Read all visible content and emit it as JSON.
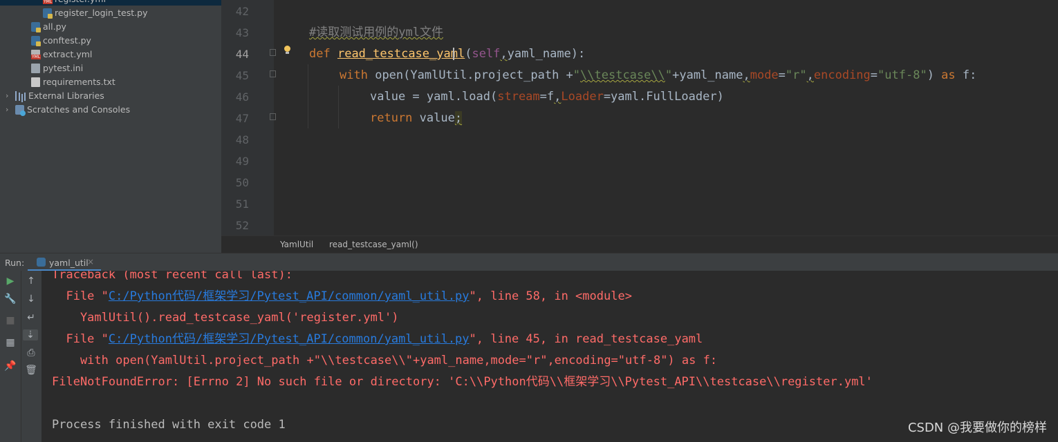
{
  "project_tree": {
    "items": [
      {
        "label": "register.yml",
        "icon": "yml-file-icon"
      },
      {
        "label": "register_login_test.py",
        "icon": "python-file-icon"
      },
      {
        "label": "all.py",
        "icon": "python-file-icon"
      },
      {
        "label": "conftest.py",
        "icon": "python-file-icon"
      },
      {
        "label": "extract.yml",
        "icon": "yml-file-icon"
      },
      {
        "label": "pytest.ini",
        "icon": "ini-file-icon"
      },
      {
        "label": "requirements.txt",
        "icon": "text-file-icon"
      },
      {
        "label": "External Libraries",
        "icon": "library-icon"
      },
      {
        "label": "Scratches and Consoles",
        "icon": "scratches-icon"
      }
    ]
  },
  "editor": {
    "line_numbers": [
      "42",
      "43",
      "44",
      "45",
      "46",
      "47",
      "48",
      "49",
      "50",
      "51",
      "52"
    ],
    "current_line": "44",
    "comment": "#读取测试用例的yml文件",
    "def_kw": "def",
    "func_name_a": "read_testcase_y",
    "func_name_b": "aml",
    "paren_open": "(",
    "self_kw": "self",
    "comma": ",",
    "params_end": "yaml_name):",
    "with_kw": "with",
    "open_call": "open(YamlUtil.project_path +",
    "str_q1": "\"",
    "str_path": "\\\\testcase\\\\",
    "str_q2": "\"",
    "plus_name": "+yaml_name",
    "mode_kw": "mode",
    "eq": "=",
    "mode_val": "\"r\"",
    "encoding_kw": "encoding",
    "encoding_val": "\"utf-8\"",
    "close_paren": ") ",
    "as_kw": "as",
    "as_tail": " f:",
    "value_assign": "value = yaml.load(",
    "stream_kw": "stream",
    "eq_f": "=f",
    "loader_kw": "Loader",
    "loader_tail": "=yaml.FullLoader)",
    "return_kw": "return",
    "return_val": " value",
    "semicolon": ";"
  },
  "breadcrumb": {
    "class": "YamlUtil",
    "method": "read_testcase_yaml()"
  },
  "run_panel": {
    "label": "Run:",
    "tab": "yaml_util",
    "output": {
      "l1": "Traceback (most recent call last):",
      "l2_pre": "  File \"",
      "l2_link": "C:/Python代码/框架学习/Pytest_API/common/yaml_util.py",
      "l2_post": "\", line 58, in <module>",
      "l3": "    YamlUtil().read_testcase_yaml('register.yml')",
      "l4_pre": "  File \"",
      "l4_link": "C:/Python代码/框架学习/Pytest_API/common/yaml_util.py",
      "l4_post": "\", line 45, in read_testcase_yaml",
      "l5": "    with open(YamlUtil.project_path +\"\\\\testcase\\\\\"+yaml_name,mode=\"r\",encoding=\"utf-8\") as f:",
      "l6": "FileNotFoundError: [Errno 2] No such file or directory: 'C:\\\\Python代码\\\\框架学习\\\\Pytest_API\\\\testcase\\\\register.yml'",
      "l8": "Process finished with exit code 1"
    }
  },
  "watermark": "CSDN @我要做你的榜样",
  "colors": {
    "error_red": "#ff6b68",
    "link_blue": "#287bde",
    "keyword": "#cc7832",
    "string": "#6a8759"
  }
}
